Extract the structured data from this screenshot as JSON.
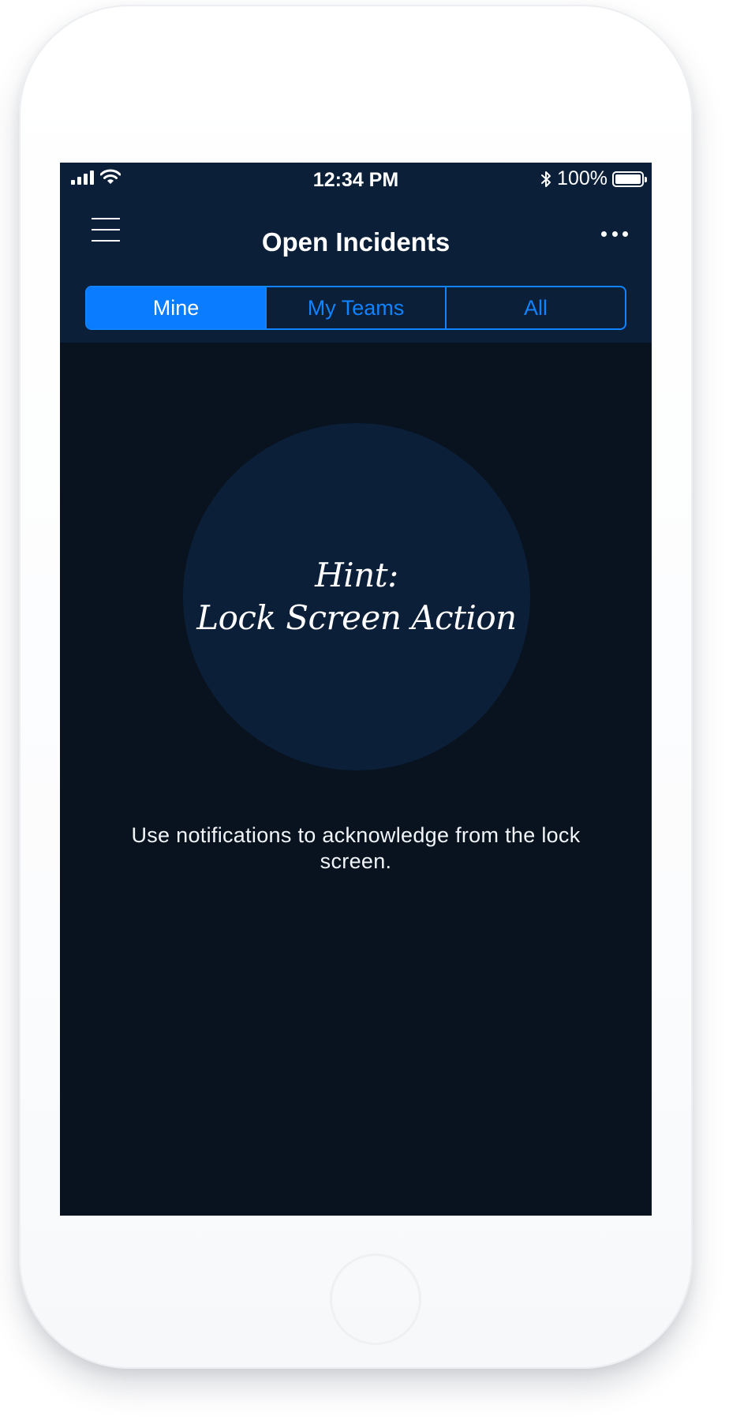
{
  "status_bar": {
    "time": "12:34 PM",
    "battery_percent": "100%",
    "icons": [
      "signal-icon",
      "wifi-icon",
      "bluetooth-icon",
      "battery-icon"
    ]
  },
  "header": {
    "title": "Open Incidents",
    "menu_icon": "hamburger-menu-icon",
    "more_icon": "more-options-icon"
  },
  "tabs": [
    {
      "label": "Mine",
      "selected": true
    },
    {
      "label": "My Teams",
      "selected": false
    },
    {
      "label": "All",
      "selected": false
    }
  ],
  "hint": {
    "line1": "Hint:",
    "line2": "Lock Screen Action"
  },
  "message": "Use notifications to acknowledge from the lock screen.",
  "colors": {
    "header_bg": "#0b1f38",
    "content_bg": "#08131f",
    "accent": "#0a7cff",
    "hint_circle_bg": "#0b1f38",
    "text": "#ffffff"
  }
}
